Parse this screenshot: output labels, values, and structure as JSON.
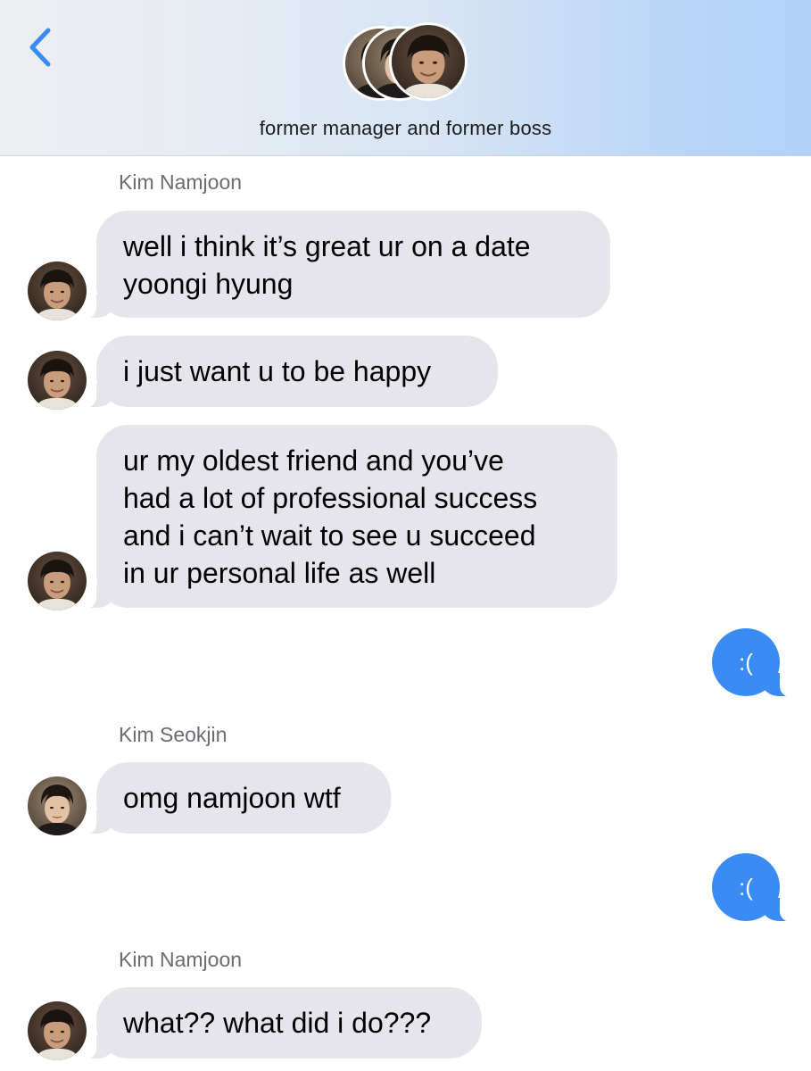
{
  "header": {
    "back_icon": "chevron-left-icon",
    "group_name": "former manager and former boss",
    "accent_color": "#3a8cf4"
  },
  "thread": {
    "sender_1": "Kim Namjoon",
    "msg_1_line1": "well i think it’s great ur on a date",
    "msg_1_line2": "yoongi hyung",
    "msg_2": "i just want u to be happy",
    "msg_3_line1": "ur my oldest friend and you’ve",
    "msg_3_line2": "had a lot of professional success",
    "msg_3_line3": "and i can’t wait to see u succeed",
    "msg_3_line4": "in ur personal life as well",
    "out_1": ":(",
    "sender_2": "Kim Seokjin",
    "msg_4": "omg namjoon wtf",
    "out_2": ":(",
    "sender_3": "Kim Namjoon",
    "msg_5": "what?? what did i do???"
  },
  "colors": {
    "incoming_bubble": "#e6e5eb",
    "outgoing_bubble": "#3a8cf4",
    "sender_name": "#6b6b70"
  }
}
